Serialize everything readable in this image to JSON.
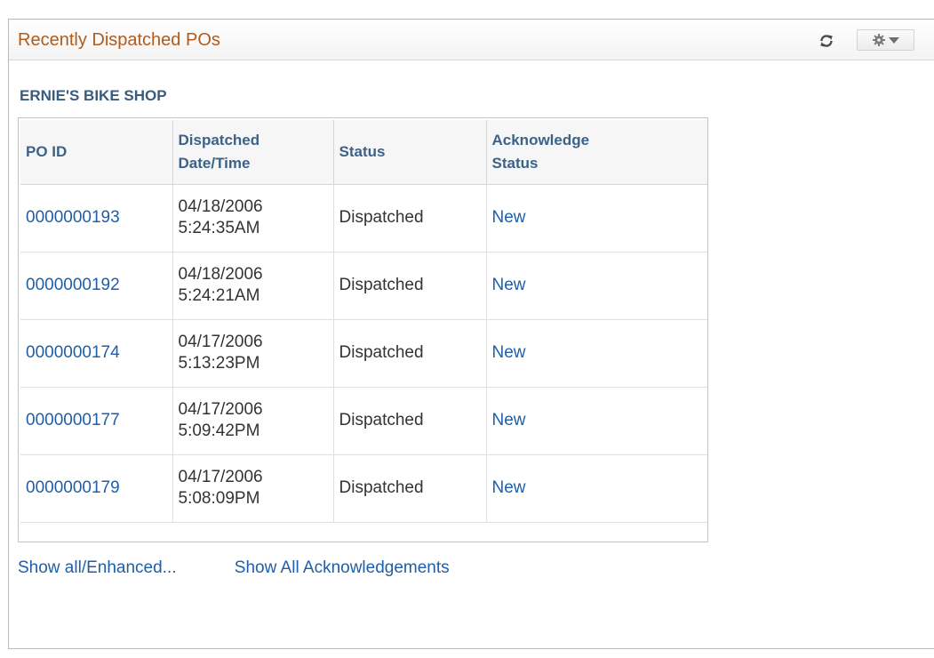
{
  "pagelet": {
    "title": "Recently Dispatched POs",
    "icons": {
      "refresh": "refresh-icon",
      "options": "gear-icon"
    }
  },
  "company": "ERNIE'S BIKE SHOP",
  "table": {
    "headers": {
      "po_id": "PO ID",
      "dispatched_line1": "Dispatched",
      "dispatched_line2": "Date/Time",
      "status": "Status",
      "ack_line1": "Acknowledge",
      "ack_line2": "Status"
    },
    "rows": [
      {
        "po_id": "0000000193",
        "date": "04/18/2006",
        "time": "5:24:35AM",
        "status": "Dispatched",
        "ack": "New"
      },
      {
        "po_id": "0000000192",
        "date": "04/18/2006",
        "time": "5:24:21AM",
        "status": "Dispatched",
        "ack": "New"
      },
      {
        "po_id": "0000000174",
        "date": "04/17/2006",
        "time": "5:13:23PM",
        "status": "Dispatched",
        "ack": "New"
      },
      {
        "po_id": "0000000177",
        "date": "04/17/2006",
        "time": "5:09:42PM",
        "status": "Dispatched",
        "ack": "New"
      },
      {
        "po_id": "0000000179",
        "date": "04/17/2006",
        "time": "5:08:09PM",
        "status": "Dispatched",
        "ack": "New"
      }
    ]
  },
  "footer": {
    "show_all": "Show all/Enhanced...",
    "show_acks": "Show All Acknowledgements"
  },
  "colors": {
    "title": "#b25b1b",
    "link": "#1f5ea8",
    "header_text": "#3d6288"
  }
}
